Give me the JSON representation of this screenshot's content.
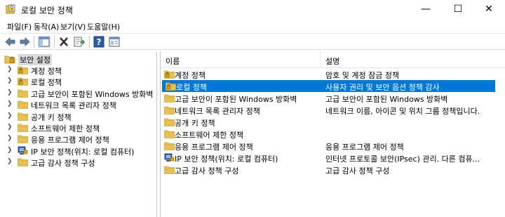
{
  "window": {
    "title": "로컬 보안 정책",
    "minimize_glyph": "—",
    "maximize_glyph": "☐",
    "close_glyph": "✕"
  },
  "menu": [
    "파일(F)",
    "동작(A)",
    "보기(V)",
    "도움말(H)"
  ],
  "toolbar": {
    "icons": [
      "back-arrow-icon",
      "forward-arrow-icon",
      "show-hide-tree-icon",
      "delete-icon",
      "export-list-icon",
      "help-icon",
      "properties-icon"
    ]
  },
  "tree": {
    "root": "보안 설정",
    "items": [
      {
        "label": "계정 정책",
        "icon": "folder-lock-icon"
      },
      {
        "label": "로컬 정책",
        "icon": "folder-lock-icon"
      },
      {
        "label": "고급 보안이 포함된 Windows 방화벽",
        "icon": "folder-icon"
      },
      {
        "label": "네트워크 목록 관리자 정책",
        "icon": "folder-icon"
      },
      {
        "label": "공개 키 정책",
        "icon": "folder-icon"
      },
      {
        "label": "소프트웨어 제한 정책",
        "icon": "folder-icon"
      },
      {
        "label": "응용 프로그램 제어 정책",
        "icon": "folder-icon"
      },
      {
        "label": "IP 보안 정책(위치: 로컬 컴퓨터)",
        "icon": "ip-security-icon"
      },
      {
        "label": "고급 감사 정책 구성",
        "icon": "folder-icon"
      }
    ]
  },
  "list": {
    "columns": {
      "name": "이름",
      "description": "설명"
    },
    "selected_index": 1,
    "rows": [
      {
        "name": "계정 정책",
        "description": "암호 및 계정 잠금 정책",
        "icon": "folder-lock-icon"
      },
      {
        "name": "로컬 정책",
        "description": "사용자 권리 및 보안 옵션 정책 감사",
        "icon": "folder-lock-icon"
      },
      {
        "name": "고급 보안이 포함된 Windows 방화벽",
        "description": "고급 보안이 포함된 Windows 방화벽",
        "icon": "folder-icon"
      },
      {
        "name": "네트워크 목록 관리자 정책",
        "description": "네트워크 이름, 아이콘 및 위치 그룹 정책입니다.",
        "icon": "folder-icon"
      },
      {
        "name": "공개 키 정책",
        "description": "",
        "icon": "folder-icon"
      },
      {
        "name": "소프트웨어 제한 정책",
        "description": "",
        "icon": "folder-icon"
      },
      {
        "name": "응용 프로그램 제어 정책",
        "description": "응용 프로그램 제어 정책",
        "icon": "folder-icon"
      },
      {
        "name": "IP 보안 정책(위치: 로컬 컴퓨터)",
        "description": "인터넷 프로토콜 보안(IPsec) 관리. 다른 컴퓨...",
        "icon": "ip-security-icon"
      },
      {
        "name": "고급 감사 정책 구성",
        "description": "고급 감사 정책 구성",
        "icon": "folder-icon"
      }
    ]
  },
  "colors": {
    "selection": "#0078d7",
    "folder": "#e8c05a",
    "folder_dark": "#d4a52f"
  }
}
